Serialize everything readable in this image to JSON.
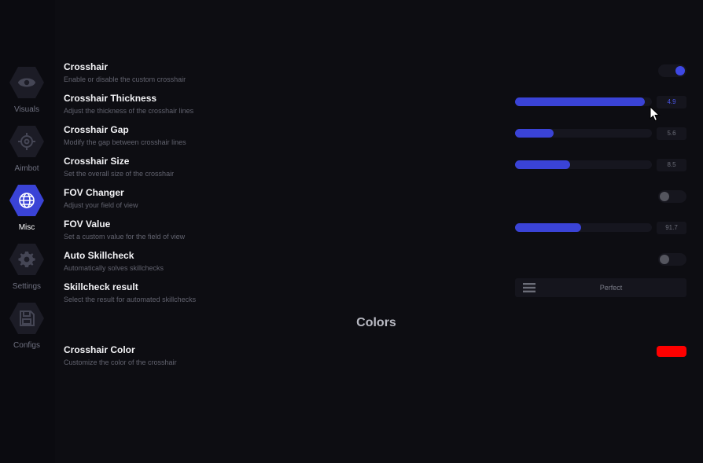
{
  "sidebar": {
    "items": [
      {
        "label": "Visuals",
        "icon": "eye-icon",
        "active": false
      },
      {
        "label": "Aimbot",
        "icon": "crosshair-icon",
        "active": false
      },
      {
        "label": "Misc",
        "icon": "globe-icon",
        "active": true
      },
      {
        "label": "Settings",
        "icon": "gear-icon",
        "active": false
      },
      {
        "label": "Configs",
        "icon": "save-icon",
        "active": false
      }
    ]
  },
  "settings": {
    "crosshair": {
      "title": "Crosshair",
      "desc": "Enable or disable the custom crosshair",
      "enabled": true
    },
    "thickness": {
      "title": "Crosshair Thickness",
      "desc": "Adjust the thickness of the crosshair lines",
      "value": "4.9",
      "fill": 0.95
    },
    "gap": {
      "title": "Crosshair Gap",
      "desc": "Modify the gap between crosshair lines",
      "value": "5.6",
      "fill": 0.28
    },
    "size": {
      "title": "Crosshair Size",
      "desc": "Set the overall size of the crosshair",
      "value": "8.5",
      "fill": 0.4
    },
    "fov_changer": {
      "title": "FOV Changer",
      "desc": "Adjust your field of view",
      "enabled": false
    },
    "fov_value": {
      "title": "FOV Value",
      "desc": "Set a custom value for the field of view",
      "value": "91.7",
      "fill": 0.48
    },
    "auto_skillcheck": {
      "title": "Auto Skillcheck",
      "desc": "Automatically solves skillchecks",
      "enabled": false
    },
    "skillcheck_result": {
      "title": "Skillcheck result",
      "desc": "Select the result for automated skillchecks",
      "value": "Perfect"
    }
  },
  "colors": {
    "section_title": "Colors",
    "crosshair_color": {
      "title": "Crosshair Color",
      "desc": "Customize the color of the crosshair",
      "color": "#ff0000"
    }
  },
  "theme": {
    "accent": "#3a43d6",
    "background": "#0d0d12"
  }
}
